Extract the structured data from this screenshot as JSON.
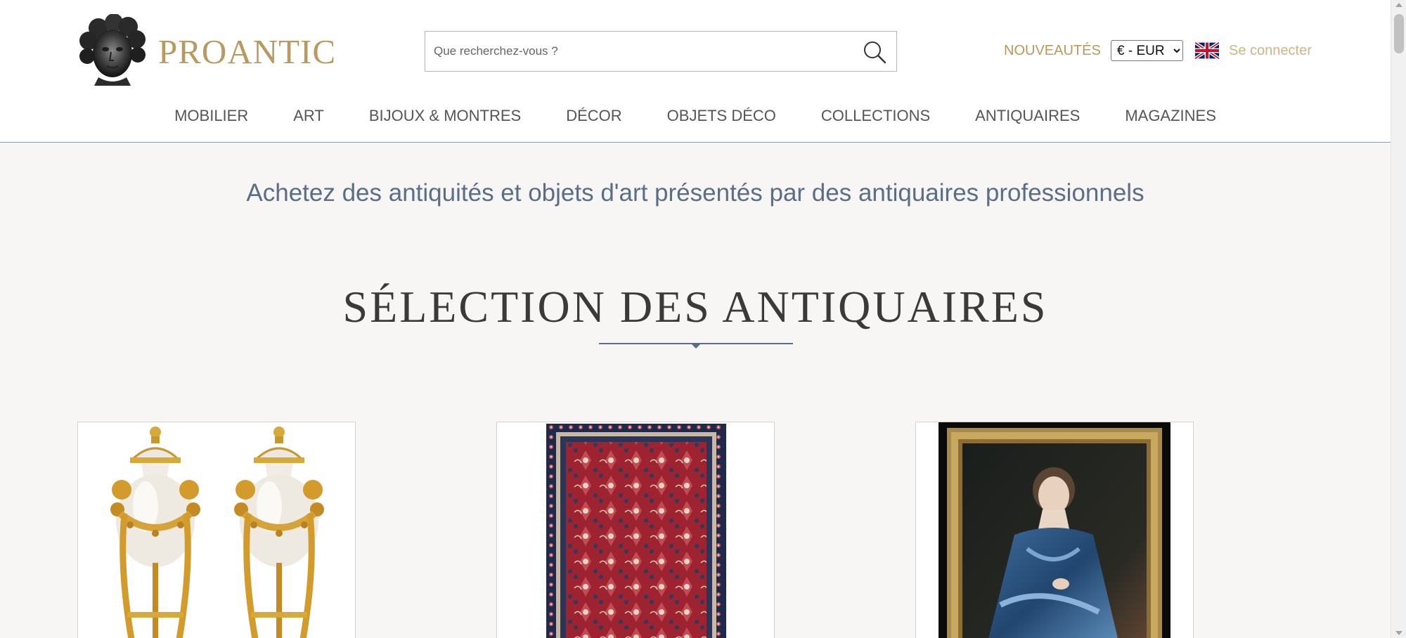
{
  "header": {
    "brand": "PROANTIC",
    "search_placeholder": "Que recherchez-vous ?",
    "nouveautes": "NOUVEAUTÉS",
    "currency_options": [
      "€ - EUR"
    ],
    "login": "Se connecter",
    "colors": {
      "gold": "#b8995e",
      "login": "#cfb585",
      "rule": "#5a6e87"
    }
  },
  "nav": {
    "items": [
      "MOBILIER",
      "ART",
      "BIJOUX & MONTRES",
      "DÉCOR",
      "OBJETS DÉCO",
      "COLLECTIONS",
      "ANTIQUAIRES",
      "MAGAZINES"
    ]
  },
  "main": {
    "tagline": "Achetez des antiquités et objets d'art présentés par des antiquaires professionnels",
    "section_title": "SÉLECTION DES ANTIQUAIRES"
  },
  "icons": {
    "search": "search-icon",
    "flag": "uk-flag-icon",
    "logo": "cherub-head-logo"
  }
}
